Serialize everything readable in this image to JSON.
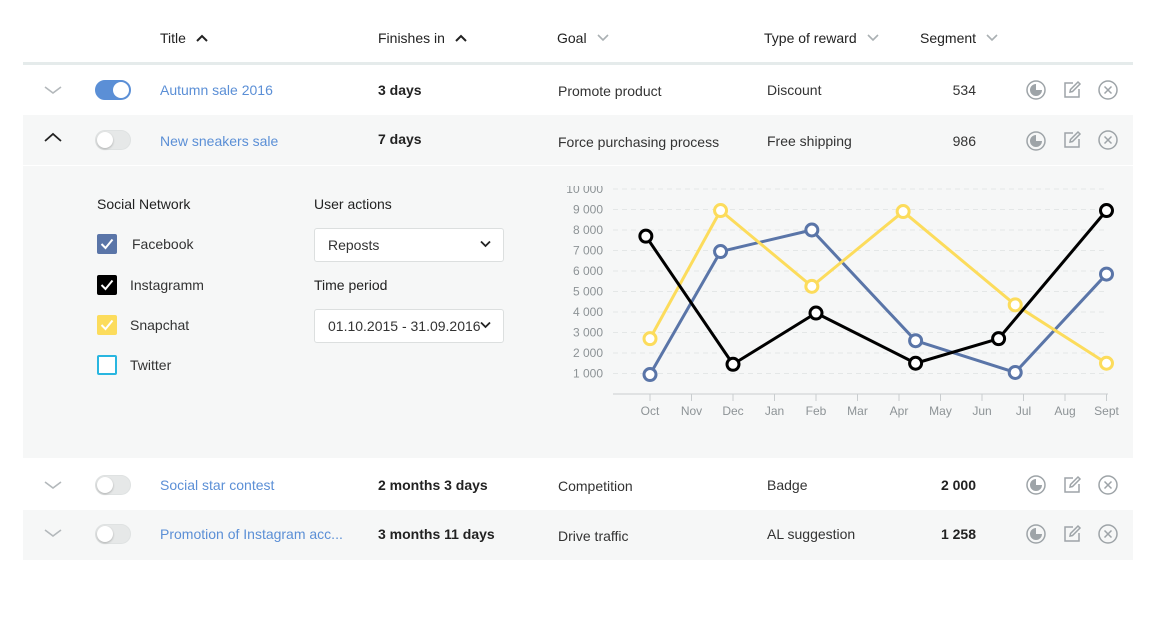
{
  "header": {
    "columns": [
      {
        "label": "Title"
      },
      {
        "label": "Finishes in"
      },
      {
        "label": "Goal"
      },
      {
        "label": "Type of reward"
      },
      {
        "label": "Segment"
      }
    ]
  },
  "rows": [
    {
      "title": "Autumn sale 2016",
      "finishes": "3 days",
      "goal": "Promote product",
      "reward": "Discount",
      "segment": "534",
      "active": true,
      "expanded": false
    },
    {
      "title": "New sneakers sale",
      "finishes": "7 days",
      "goal": "Force purchasing process",
      "reward": "Free shipping",
      "segment": "986",
      "active": false,
      "expanded": true
    },
    {
      "title": "Social star contest",
      "finishes": "2 months 3 days",
      "goal": "Competition",
      "reward": "Badge",
      "segment": "2 000",
      "active": false,
      "expanded": false
    },
    {
      "title": "Promotion of Instagram acc...",
      "finishes": "3 months 11 days",
      "goal": "Drive traffic",
      "reward": "AL suggestion",
      "segment": "1 258",
      "active": false,
      "expanded": false
    }
  ],
  "details": {
    "social_network_title": "Social Network",
    "networks": [
      {
        "label": "Facebook",
        "checked": true,
        "color": "#5a75a8"
      },
      {
        "label": "Instagramm",
        "checked": true,
        "color": "#000000"
      },
      {
        "label": "Snapchat",
        "checked": true,
        "color": "#fcdc5c"
      },
      {
        "label": "Twitter",
        "checked": false,
        "color": "#29b6e0"
      }
    ],
    "user_actions_title": "User actions",
    "user_actions_value": "Reposts",
    "time_period_title": "Time period",
    "time_period_value": "01.10.2015 - 31.09.2016"
  },
  "chart_data": {
    "type": "line",
    "categories": [
      "Oct",
      "Nov",
      "Dec",
      "Jan",
      "Feb",
      "Mar",
      "Apr",
      "May",
      "Jun",
      "Jul",
      "Aug",
      "Sept"
    ],
    "yticks": [
      "1 000",
      "2 000",
      "3 000",
      "4 000",
      "5 000",
      "6 000",
      "7 000",
      "8 000",
      "9 000",
      "10 000"
    ],
    "ylim": [
      0,
      10000
    ],
    "grid": true,
    "series": [
      {
        "color": "#5a75a8",
        "points": [
          [
            0,
            950
          ],
          [
            1.7,
            6950
          ],
          [
            3.9,
            8000
          ],
          [
            6.4,
            2600
          ],
          [
            8.8,
            1050
          ],
          [
            11,
            5850
          ]
        ]
      },
      {
        "color": "#fcdc5c",
        "points": [
          [
            0,
            2700
          ],
          [
            1.7,
            8950
          ],
          [
            3.9,
            5250
          ],
          [
            6.1,
            8900
          ],
          [
            8.8,
            4350
          ],
          [
            11,
            1500
          ]
        ]
      },
      {
        "color": "#000000",
        "points": [
          [
            -0.1,
            7700
          ],
          [
            2,
            1450
          ],
          [
            4,
            3950
          ],
          [
            6.4,
            1500
          ],
          [
            8.4,
            2700
          ],
          [
            11,
            8950
          ]
        ]
      }
    ]
  },
  "colors": {
    "accent": "#5b8fd6",
    "icon_grey": "#9ea4a8",
    "row_alt": "#f6f7f7"
  },
  "icons": {
    "sort_up": "chevron-up-icon",
    "sort_down": "chevron-down-icon",
    "stats": "pie-chart-icon",
    "edit": "edit-icon",
    "delete": "close-circle-icon"
  }
}
